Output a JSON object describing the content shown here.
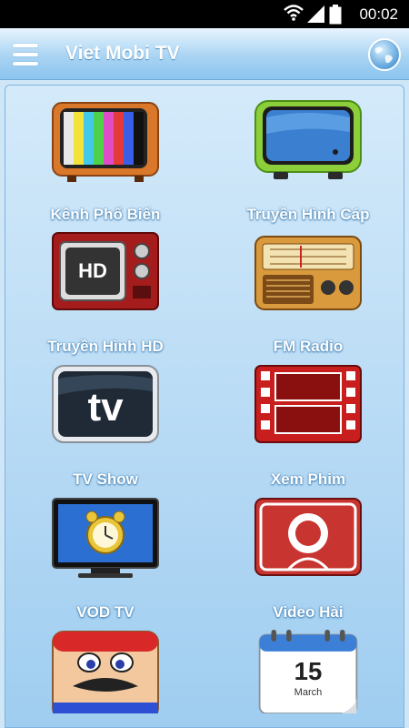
{
  "status_bar": {
    "time": "00:02"
  },
  "app_bar": {
    "title": "Viet Mobi TV"
  },
  "tiles": [
    {
      "label": "Kênh Phổ Biến",
      "icon": "retro-tv-color-bars-icon"
    },
    {
      "label": "Truyền Hình Cáp",
      "icon": "modern-tv-icon"
    },
    {
      "label": "Truyền Hình HD",
      "icon": "hd-tv-icon"
    },
    {
      "label": "FM Radio",
      "icon": "radio-icon"
    },
    {
      "label": "TV Show",
      "icon": "tv-text-icon"
    },
    {
      "label": "Xem Phim",
      "icon": "film-strip-icon"
    },
    {
      "label": "VOD TV",
      "icon": "alarm-clock-tv-icon"
    },
    {
      "label": "Video Hài",
      "icon": "video-play-icon"
    },
    {
      "label": "",
      "icon": "mario-face-icon"
    },
    {
      "label": "",
      "icon": "calendar-icon",
      "calendar_day": "15",
      "calendar_month": "March"
    }
  ]
}
